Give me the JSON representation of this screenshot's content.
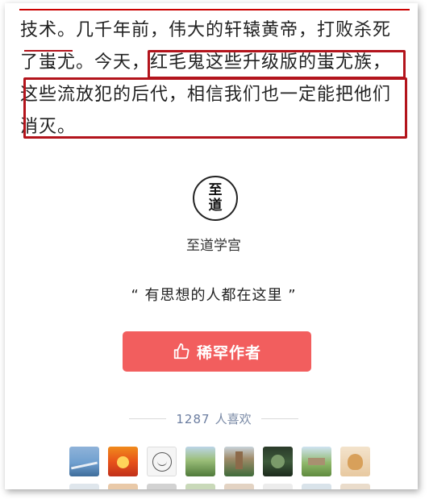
{
  "article": {
    "line1_a": "技术。",
    "line1_b": "几千年前，伟大的轩辕黄帝，打败杀死",
    "line2_a": "了蚩尤。今天，",
    "line2_b": "红毛鬼这些升级版的蚩尤族，",
    "line3": "这些流放犯的后代，相信我们也一定能把他们",
    "line4": "消灭。"
  },
  "publisher": {
    "logo_top": "至",
    "logo_bottom": "道",
    "name": "至道学宫",
    "slogan": "“ 有思想的人都在这里 ”"
  },
  "reward_button": {
    "label": "稀罕作者"
  },
  "likes": {
    "count": "1287",
    "suffix": "人喜欢"
  },
  "colors": {
    "highlight": "#b3141c",
    "button": "#f25e5e",
    "likes_text": "#6b7da0"
  }
}
